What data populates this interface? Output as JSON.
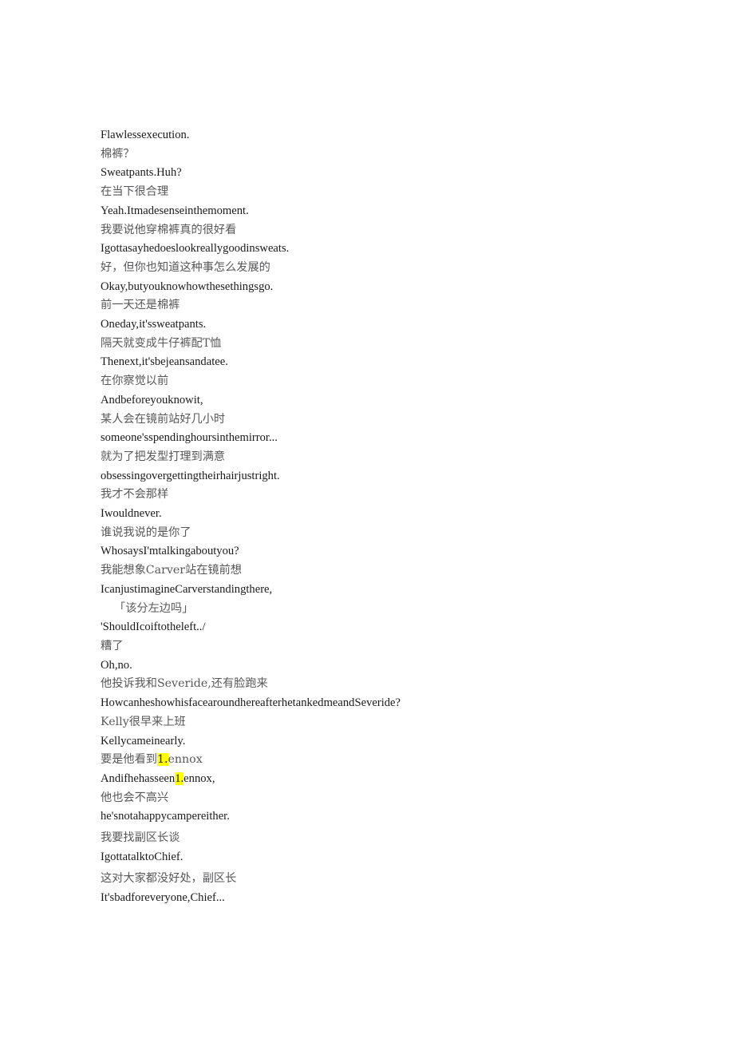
{
  "document": {
    "type": "bilingual-subtitle-transcript",
    "background_color": "#ffffff",
    "text_color_source": "#1a1a1a",
    "text_color_translation": "#58585a",
    "highlight_color": "#ffff00"
  },
  "lines": [
    {
      "id": "l01",
      "lang": "en",
      "text": "Flawlessexecution."
    },
    {
      "id": "l02",
      "lang": "zh",
      "text": "棉裤？"
    },
    {
      "id": "l03",
      "lang": "en",
      "text": "Sweatpants.Huh?"
    },
    {
      "id": "l04",
      "lang": "zh",
      "text": "在当下很合理"
    },
    {
      "id": "l05",
      "lang": "en",
      "text": "Yeah.Itmadesenseinthemoment."
    },
    {
      "id": "l06",
      "lang": "zh",
      "text": "我要说他穿棉裤真的很好看"
    },
    {
      "id": "l07",
      "lang": "en",
      "text": "Igottasayhedoeslookreallygoodinsweats."
    },
    {
      "id": "l08",
      "lang": "zh",
      "text": "好，但你也知道这种事怎么发展的"
    },
    {
      "id": "l09",
      "lang": "en",
      "text": "Okay,butyouknowhowthesethingsgo."
    },
    {
      "id": "l10",
      "lang": "zh",
      "text": "前一天还是棉裤"
    },
    {
      "id": "l11",
      "lang": "en",
      "text": "Oneday,it'ssweatpants."
    },
    {
      "id": "l12",
      "lang": "zh",
      "text": "隔天就变成牛仔裤配T恤"
    },
    {
      "id": "l13",
      "lang": "en",
      "text": "Thenext,it'sbejeansandatee."
    },
    {
      "id": "l14",
      "lang": "zh",
      "text": "在你察觉以前"
    },
    {
      "id": "l15",
      "lang": "en",
      "text": "Andbeforeyouknowit,"
    },
    {
      "id": "l16",
      "lang": "zh",
      "text": "某人会在镜前站好几小时"
    },
    {
      "id": "l17",
      "lang": "en",
      "text": "someone'sspendinghoursinthemirror..."
    },
    {
      "id": "l18",
      "lang": "zh",
      "text": "就为了把发型打理到满意"
    },
    {
      "id": "l19",
      "lang": "en",
      "text": "obsessingovergettingtheirhairjustright."
    },
    {
      "id": "l20",
      "lang": "zh",
      "text": "我才不会那样"
    },
    {
      "id": "l21",
      "lang": "en",
      "text": "Iwouldnever."
    },
    {
      "id": "l22",
      "lang": "zh",
      "text": "谁说我说的是你了"
    },
    {
      "id": "l23",
      "lang": "en",
      "text": "WhosaysI'mtalkingaboutyou?"
    },
    {
      "id": "l24",
      "lang": "zh",
      "text": "我能想象Carver站在镜前想"
    },
    {
      "id": "l25",
      "lang": "en",
      "text": "IcanjustimagineCarverstandingthere,"
    },
    {
      "id": "l26",
      "lang": "zh",
      "text": "「该分左边吗」",
      "indent": true
    },
    {
      "id": "l27",
      "lang": "en",
      "text": "'ShouldIcoiftotheleft../"
    },
    {
      "id": "l28",
      "lang": "zh",
      "text": "糟了"
    },
    {
      "id": "l29",
      "lang": "en",
      "text": "Oh,no."
    },
    {
      "id": "l30",
      "lang": "zh",
      "text": "他投诉我和Severide,还有脸跑来"
    },
    {
      "id": "l31",
      "lang": "en",
      "text": "HowcanheshowhisfacearoundhereafterhetankedmeandSeveride?"
    },
    {
      "id": "l32",
      "lang": "zh",
      "text": "Kelly很早来上班"
    },
    {
      "id": "l33",
      "lang": "en",
      "text": "Kellycameinearly."
    },
    {
      "id": "l34",
      "lang": "zh",
      "segments": [
        {
          "text": "要是他看到"
        },
        {
          "text": "1.",
          "highlight": true
        },
        {
          "text": "ennox"
        }
      ]
    },
    {
      "id": "l35",
      "lang": "en",
      "segments": [
        {
          "text": "Andifhehasseen"
        },
        {
          "text": "1.",
          "highlight": true
        },
        {
          "text": "ennox,"
        }
      ]
    },
    {
      "id": "l36",
      "lang": "zh",
      "text": "他也会不高兴"
    },
    {
      "id": "l37",
      "lang": "en",
      "text": "he'snotahappycampereither."
    },
    {
      "id": "l38",
      "lang": "zh",
      "text": "我要找副区长谈",
      "gap": true
    },
    {
      "id": "l39",
      "lang": "en",
      "text": "IgottatalktoChief."
    },
    {
      "id": "l40",
      "lang": "zh",
      "text": "这对大家都没好处，副区长",
      "gap": true
    },
    {
      "id": "l41",
      "lang": "en",
      "text": "It'sbadforeveryone,Chief..."
    }
  ]
}
